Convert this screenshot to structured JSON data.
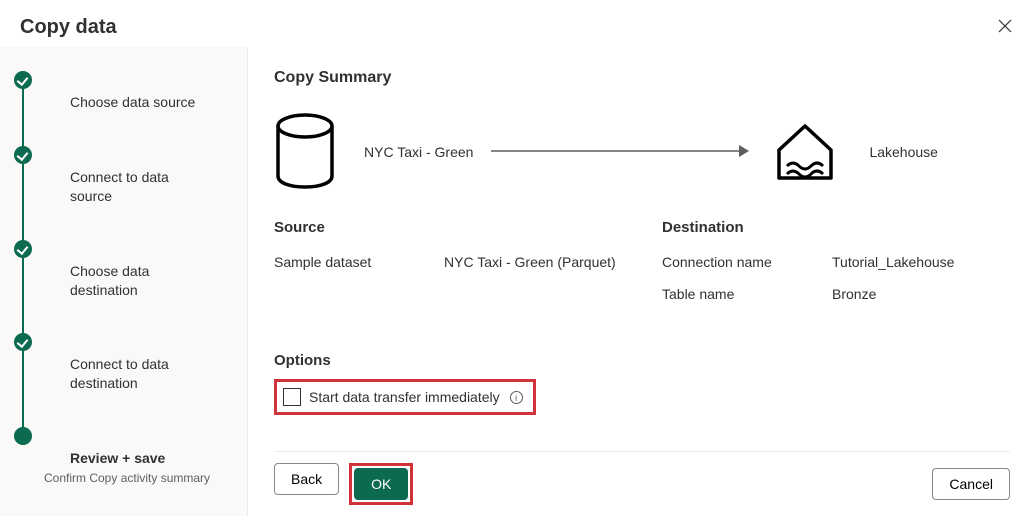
{
  "header": {
    "title": "Copy data",
    "close_icon": "close-icon"
  },
  "sidebar": {
    "steps": [
      {
        "label": "Choose data source",
        "state": "completed"
      },
      {
        "label": "Connect to data source",
        "state": "completed"
      },
      {
        "label": "Choose data destination",
        "state": "completed"
      },
      {
        "label": "Connect to data destination",
        "state": "completed"
      },
      {
        "label": "Review + save",
        "sublabel": "Confirm Copy activity summary",
        "state": "current"
      }
    ]
  },
  "main": {
    "summary_title": "Copy Summary",
    "diagram": {
      "source_label": "NYC Taxi - Green",
      "destination_label": "Lakehouse"
    },
    "source": {
      "heading": "Source",
      "rows": [
        {
          "k": "Sample dataset",
          "v": "NYC Taxi - Green (Parquet)"
        }
      ]
    },
    "destination": {
      "heading": "Destination",
      "rows": [
        {
          "k": "Connection name",
          "v": "Tutorial_Lakehouse"
        },
        {
          "k": "Table name",
          "v": "Bronze"
        }
      ]
    },
    "options": {
      "heading": "Options",
      "checkbox_label": "Start data transfer immediately",
      "checkbox_checked": false
    }
  },
  "footer": {
    "back": "Back",
    "ok": "OK",
    "cancel": "Cancel"
  }
}
